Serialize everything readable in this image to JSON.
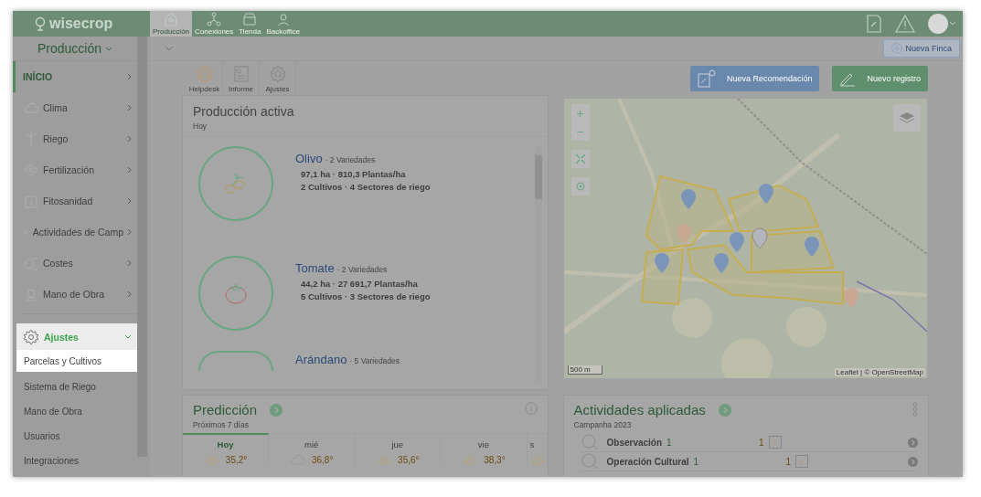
{
  "header": {
    "logo": "wisecrop",
    "tabs": [
      {
        "label": "Producción",
        "selected": true
      },
      {
        "label": "Conexiones",
        "selected": false
      },
      {
        "label": "Tienda",
        "selected": false
      },
      {
        "label": "Backoffice",
        "selected": false
      }
    ]
  },
  "farm_selector": "Producción",
  "new_farm_button": "Nueva Finca",
  "sidebar": {
    "items": [
      {
        "label": "INÍCIO",
        "selected": true
      },
      {
        "label": "Clima",
        "selected": false
      },
      {
        "label": "Riego",
        "selected": false
      },
      {
        "label": "Fertilización",
        "selected": false
      },
      {
        "label": "Fitosanidad",
        "selected": false
      },
      {
        "label": "Actividades de Camp",
        "selected": false
      },
      {
        "label": "Costes",
        "selected": false
      },
      {
        "label": "Mano de Obra",
        "selected": false
      }
    ],
    "settings": {
      "label": "Ajustes",
      "expanded": true,
      "highlighted": true,
      "children": [
        {
          "label": "Parcelas y Cultivos",
          "highlighted": true
        },
        {
          "label": "Sistema de Riego",
          "highlighted": false
        },
        {
          "label": "Mano de Obra",
          "highlighted": false
        },
        {
          "label": "Usuarios",
          "highlighted": false
        },
        {
          "label": "Integraciones",
          "highlighted": false
        }
      ]
    }
  },
  "toolbar": {
    "tools": [
      "Helpdesk",
      "Informe",
      "Ajustes"
    ],
    "buttons": [
      {
        "label": "Nueva Recomendación",
        "kind": "recommendation"
      },
      {
        "label": "Nuevo registro",
        "kind": "record"
      }
    ]
  },
  "production": {
    "title": "Producción activa",
    "subtitle": "Hoy",
    "crops": [
      {
        "kind": "olive",
        "name": "Olivo",
        "varieties": "· 2 Variedades",
        "line_1": "97,1 ha · 810,3 Plantas/ha",
        "line_2": "2 Cultivos · 4 Sectores de riego"
      },
      {
        "kind": "tomato",
        "name": "Tomate",
        "varieties": "· 2 Variedades",
        "line_1": "44,2 ha · 27 691,7 Plantas/ha",
        "line_2": "5 Cultivos · 3 Sectores de riego"
      },
      {
        "kind": "blueberry",
        "name": "Arándano",
        "varieties": "· 5 Variedades"
      }
    ]
  },
  "map": {
    "zoom_in": "+",
    "zoom_out": "−",
    "scale": "500 m",
    "attribution": "Leaflet | © OpenStreetMap"
  },
  "forecast": {
    "title": "Predicción",
    "subtitle": "Próximos 7 días",
    "days": [
      {
        "label": "Hoy",
        "selected": true,
        "max": "35,2°"
      },
      {
        "label": "mié",
        "selected": false,
        "max": "36,8°"
      },
      {
        "label": "jue",
        "selected": false,
        "max": "35,6°"
      },
      {
        "label": "vie",
        "selected": false,
        "max": "38,3°"
      },
      {
        "label": "s",
        "selected": false
      }
    ]
  },
  "activities": {
    "title": "Actividades aplicadas",
    "subtitle": "Campanha 2023",
    "rows": [
      {
        "name": "Observación",
        "count": "1",
        "pending": "1"
      },
      {
        "name": "Operación Cultural",
        "count": "1",
        "pending": "1"
      }
    ]
  }
}
